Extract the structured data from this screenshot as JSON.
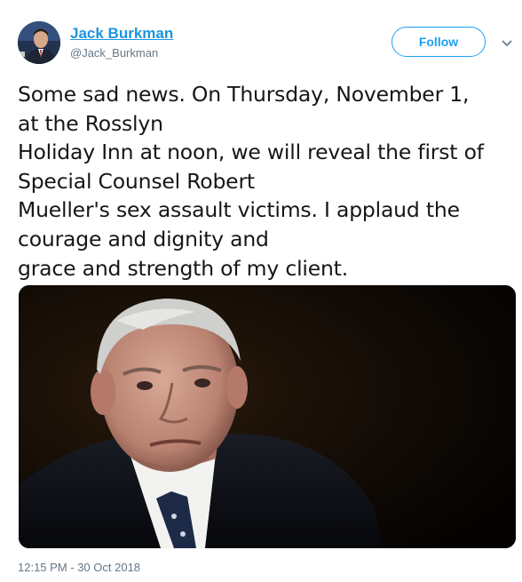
{
  "author": {
    "display_name": "Jack Burkman",
    "handle": "@Jack_Burkman",
    "avatar_icon": "user-avatar-photo"
  },
  "follow_button": {
    "label": "Follow"
  },
  "menu_icon": "chevron-down-icon",
  "tweet": {
    "lines": [
      "Some sad news.  On Thursday, November 1,",
      "at the Rosslyn",
      "Holiday Inn at noon, we will reveal the first of",
      "Special Counsel Robert",
      "Mueller's sex assault victims. I applaud the",
      "courage and dignity and",
      "grace and strength of my client."
    ]
  },
  "media": {
    "type": "photo"
  },
  "timestamp": "12:15 PM - 30 Oct 2018",
  "colors": {
    "link_blue": "#1b95e0",
    "follow_blue": "#1da1f2",
    "text": "#14171a",
    "muted": "#657786"
  }
}
